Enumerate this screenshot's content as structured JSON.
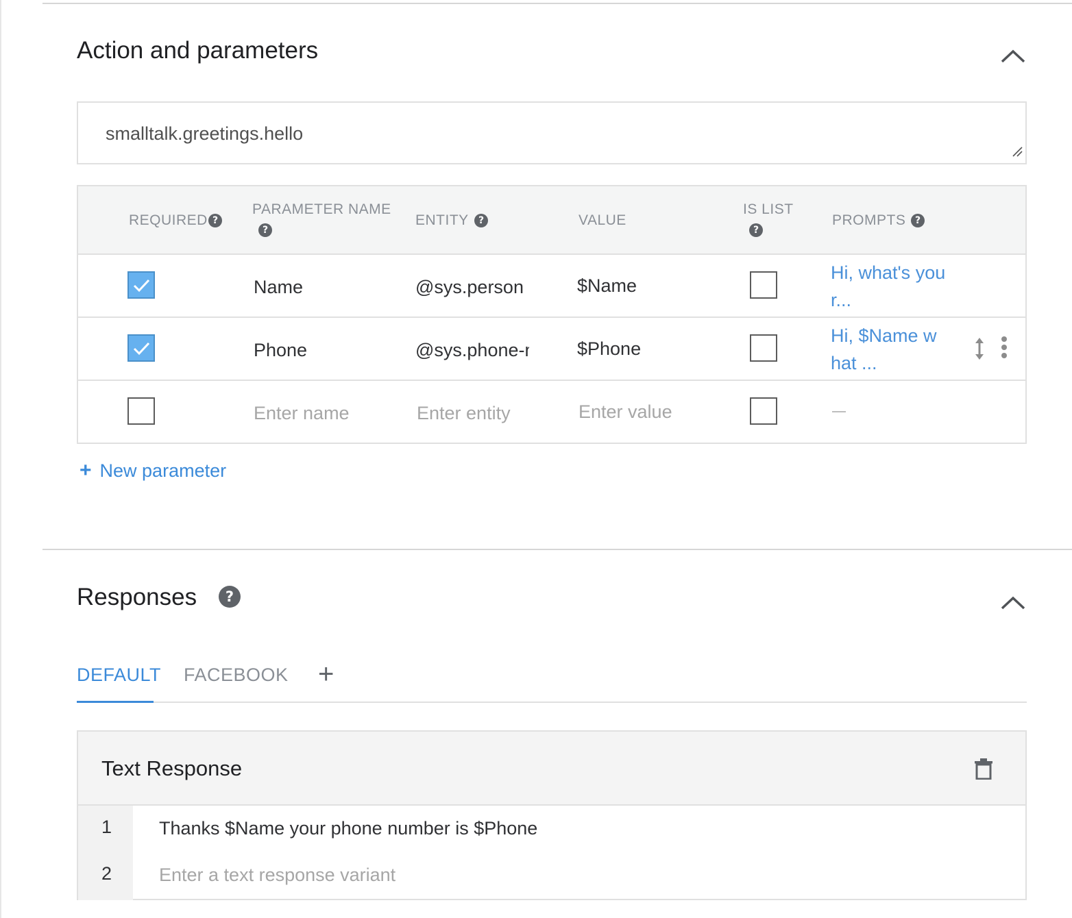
{
  "action_section": {
    "title": "Action and parameters",
    "action_value": "smalltalk.greetings.hello"
  },
  "table": {
    "headers": {
      "required": "REQUIRED",
      "parameter_name": "PARAMETER NAME",
      "entity": "ENTITY",
      "value": "VALUE",
      "is_list": "IS LIST",
      "prompts": "PROMPTS"
    },
    "rows": [
      {
        "required": true,
        "name": "Name",
        "entity": "@sys.person",
        "value": "$Name",
        "is_list": false,
        "prompt": "Hi, what's you r..."
      },
      {
        "required": true,
        "name": "Phone",
        "entity": "@sys.phone-number",
        "value": "$Phone",
        "is_list": false,
        "prompt": "Hi, $Name w hat ..."
      }
    ],
    "empty_row": {
      "required": false,
      "name_placeholder": "Enter name",
      "entity_placeholder": "Enter entity",
      "value_placeholder": "Enter value",
      "is_list": false,
      "prompt": "—"
    }
  },
  "new_parameter_label": "New parameter",
  "responses_section": {
    "title": "Responses",
    "tabs": [
      "DEFAULT",
      "FACEBOOK"
    ],
    "active_tab": "DEFAULT",
    "text_response": {
      "title": "Text Response",
      "lines": [
        {
          "number": "1",
          "text": "Thanks $Name your phone number is $Phone"
        },
        {
          "number": "2",
          "placeholder": "Enter a text response variant"
        }
      ]
    }
  },
  "colors": {
    "accent": "#3b8ad9",
    "checkbox_checked": "#66b1ef",
    "header_bg": "#f4f5f5"
  }
}
